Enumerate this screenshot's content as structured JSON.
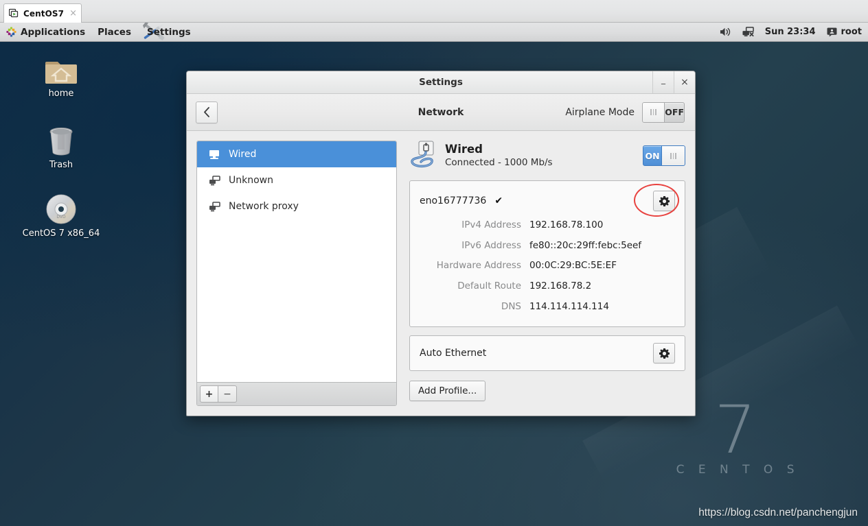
{
  "vmware": {
    "tab_label": "CentOS7",
    "tab_icon": "vm-screen-icon",
    "close_label": "×"
  },
  "panel": {
    "applications_label": "Applications",
    "places_label": "Places",
    "settings_label": "Settings",
    "clock": "Sun 23:34",
    "user": "root",
    "volume_icon": "volume-icon",
    "network_icon": "network-disconnected-icon",
    "user_icon": "user-icon",
    "apps_icon": "centos-apps-icon"
  },
  "desktop": {
    "icons": [
      {
        "label": "home",
        "icon": "home-folder-icon"
      },
      {
        "label": "Trash",
        "icon": "trash-icon"
      },
      {
        "label": "CentOS 7 x86_64",
        "icon": "dvd-disc-icon"
      }
    ],
    "brand_number": "7",
    "brand_word": "C E N T O S",
    "watermark_url": "https://blog.csdn.net/panchengjun"
  },
  "window": {
    "title": "Settings",
    "minimize_label": "_",
    "close_label": "×",
    "back_icon": "chevron-left-icon",
    "header_title": "Network",
    "airplane_label": "Airplane Mode",
    "airplane_state": "OFF"
  },
  "sidebar": {
    "items": [
      {
        "label": "Wired",
        "icon": "wired-device-icon",
        "selected": true
      },
      {
        "label": "Unknown",
        "icon": "network-device-icon",
        "selected": false
      },
      {
        "label": "Network proxy",
        "icon": "network-device-icon",
        "selected": false
      }
    ],
    "add_label": "+",
    "remove_label": "−"
  },
  "network": {
    "device_icon": "wired-cable-icon",
    "device_name": "Wired",
    "device_status": "Connected - 1000 Mb/s",
    "device_switch_state": "ON",
    "connection_name": "eno16777736",
    "connection_check": "✔",
    "settings_icon": "gear-icon",
    "details": [
      {
        "label": "IPv4 Address",
        "value": "192.168.78.100"
      },
      {
        "label": "IPv6 Address",
        "value": "fe80::20c:29ff:febc:5eef"
      },
      {
        "label": "Hardware Address",
        "value": "00:0C:29:BC:5E:EF"
      },
      {
        "label": "Default Route",
        "value": "192.168.78.2"
      },
      {
        "label": "DNS",
        "value": "114.114.114.114"
      }
    ],
    "profile_name": "Auto Ethernet",
    "profile_settings_icon": "gear-icon",
    "add_profile_label": "Add Profile..."
  },
  "colors": {
    "accent_blue": "#4a90d9",
    "switch_on": "#5294e2",
    "annotation_red": "#e8423f",
    "desktop_bg": "#1d3648"
  }
}
